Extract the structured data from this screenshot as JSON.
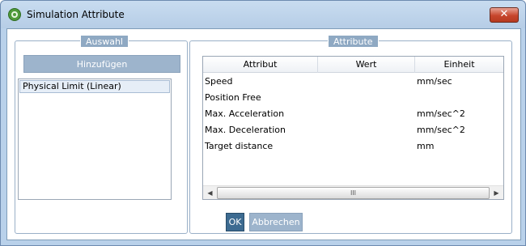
{
  "window": {
    "title": "Simulation Attribute",
    "close_glyph": "✕"
  },
  "auswahl": {
    "title": "Auswahl",
    "add_button": "Hinzufügen",
    "items": [
      "Physical Limit (Linear)"
    ]
  },
  "attribute": {
    "title": "Attribute",
    "columns": [
      "Attribut",
      "Wert",
      "Einheit"
    ],
    "rows": [
      {
        "attribut": "Speed",
        "wert": "",
        "einheit": "mm/sec"
      },
      {
        "attribut": "Position Free",
        "wert": "",
        "einheit": ""
      },
      {
        "attribut": "Max. Acceleration",
        "wert": "",
        "einheit": "mm/sec^2"
      },
      {
        "attribut": "Max. Deceleration",
        "wert": "",
        "einheit": "mm/sec^2"
      },
      {
        "attribut": "Target distance",
        "wert": "",
        "einheit": "mm"
      }
    ],
    "scroll_left": "◀",
    "scroll_right": "▶",
    "scroll_grip": "III"
  },
  "footer": {
    "ok": "OK",
    "cancel": "Abbrechen"
  }
}
